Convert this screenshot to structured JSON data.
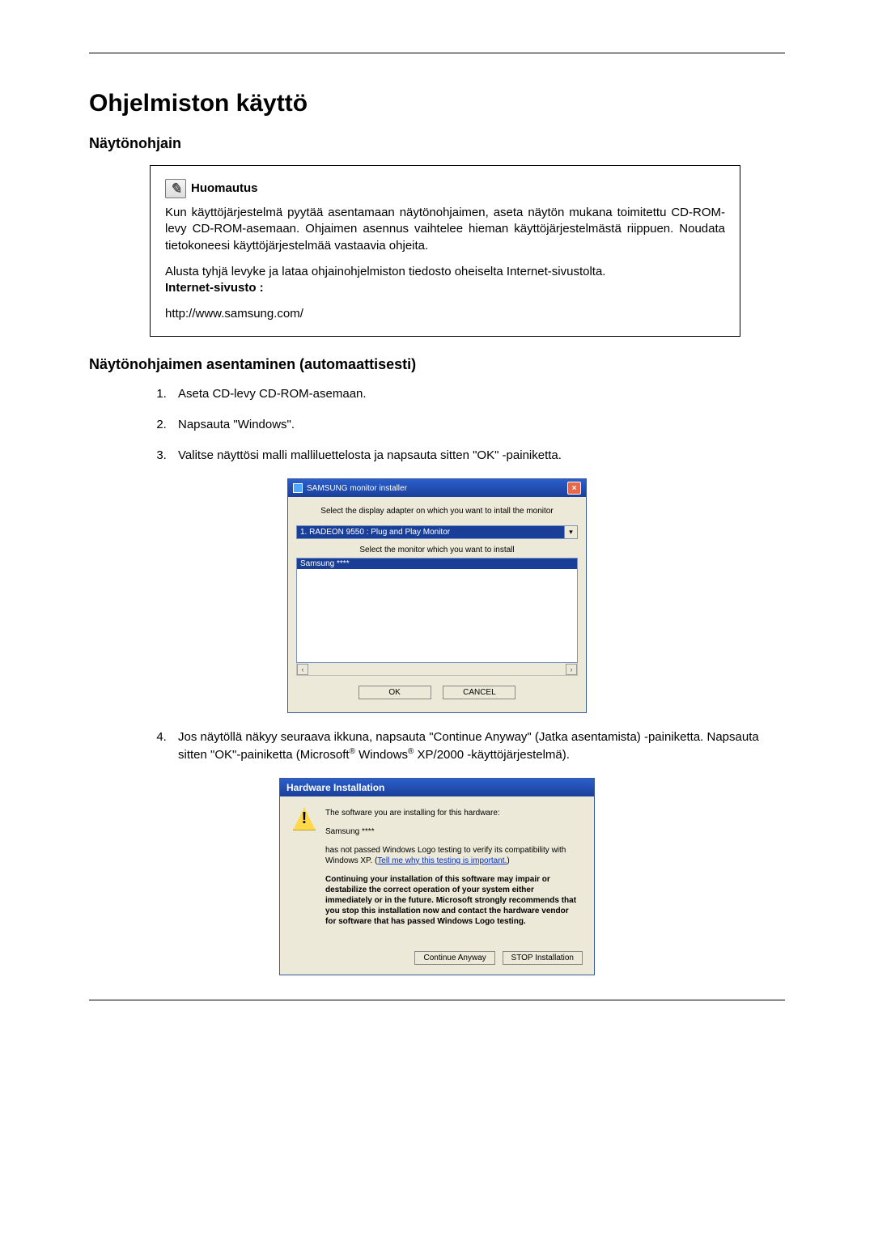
{
  "page": {
    "title": "Ohjelmiston käyttö",
    "section1": "Näytönohjain",
    "section2": "Näytönohjaimen asentaminen (automaattisesti)"
  },
  "note": {
    "icon_glyph": "✎",
    "title": "Huomautus",
    "p1": "Kun käyttöjärjestelmä pyytää asentamaan näytönohjaimen, aseta näytön mukana toimitettu CD-ROM-levy CD-ROM-asemaan. Ohjaimen asennus vaihtelee hieman käyttöjärjestelmästä riippuen. Noudata tietokoneesi käyttöjärjestelmää vastaavia ohjeita.",
    "p2": "Alusta tyhjä levyke ja lataa ohjainohjelmiston tiedosto oheiselta Internet-sivustolta.",
    "p3_label": "Internet-sivusto :",
    "url": "http://www.samsung.com/"
  },
  "steps": {
    "s1": "Aseta CD-levy CD-ROM-asemaan.",
    "s2": "Napsauta \"Windows\".",
    "s3": "Valitse näyttösi malli malliluettelosta ja napsauta sitten \"OK\" -painiketta.",
    "s4a": "Jos näytöllä näkyy seuraava ikkuna, napsauta \"Continue Anyway\" (Jatka asentamista) -painiketta. Napsauta sitten \"OK\"-painiketta (Microsoft",
    "s4b": " Windows",
    "s4c": " XP/2000 -käyttöjärjestelmä)."
  },
  "dlg1": {
    "title": "SAMSUNG monitor installer",
    "close": "×",
    "label1": "Select the display adapter on which you want to intall the monitor",
    "combo": "1. RADEON 9550 : Plug and Play Monitor",
    "combo_arrow": "▾",
    "label2": "Select the monitor which you want to install",
    "list_sel": "Samsung ****",
    "scroll_l": "‹",
    "scroll_r": "›",
    "ok": "OK",
    "cancel": "CANCEL"
  },
  "dlg2": {
    "title": "Hardware Installation",
    "warn_glyph": "!",
    "p1": "The software you are installing for this hardware:",
    "p2": "Samsung ****",
    "p3a": "has not passed Windows Logo testing to verify its compatibility with Windows XP. (",
    "link": "Tell me why this testing is important.",
    "p3b": ")",
    "p4": "Continuing your installation of this software may impair or destabilize the correct operation of your system either immediately or in the future. Microsoft strongly recommends that you stop this installation now and contact the hardware vendor for software that has passed Windows Logo testing.",
    "btn_continue": "Continue Anyway",
    "btn_stop": "STOP Installation"
  }
}
